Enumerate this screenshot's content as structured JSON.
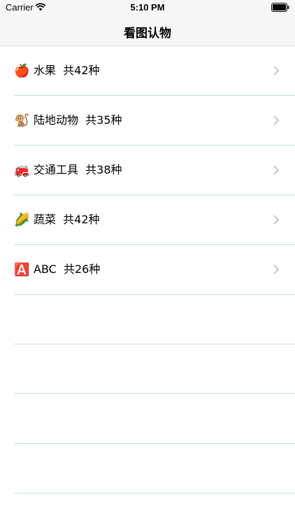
{
  "status_bar": {
    "carrier": "Carrier",
    "time": "5:10 PM"
  },
  "nav": {
    "title": "看图认物"
  },
  "categories": [
    {
      "icon": "apple-icon",
      "glyph": "🍎",
      "label": "水果  共42种"
    },
    {
      "icon": "monkey-icon",
      "glyph": "🐒",
      "label": "陆地动物  共35种"
    },
    {
      "icon": "fire-truck-icon",
      "glyph": "🚒",
      "label": "交通工具  共38种"
    },
    {
      "icon": "corn-icon",
      "glyph": "🌽",
      "label": "蔬菜  共42种"
    },
    {
      "icon": "abc-icon",
      "glyph": "🅰️",
      "label": "ABC  共26种"
    }
  ],
  "colors": {
    "separator": "#c6dde6",
    "bar_background": "#f7f7f7",
    "chevron": "#c7c7cc"
  }
}
